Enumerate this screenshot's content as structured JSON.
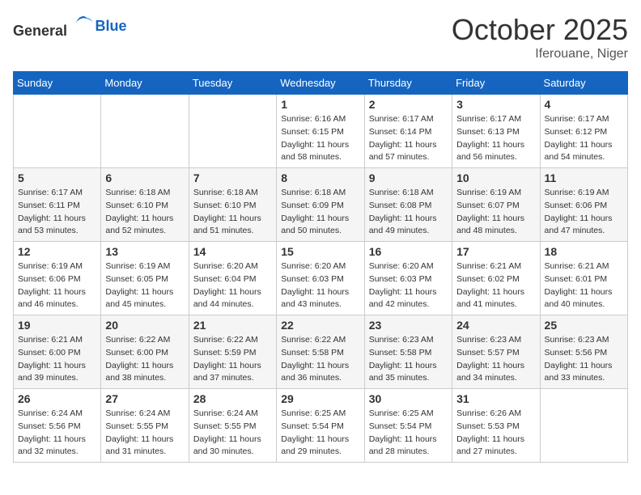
{
  "header": {
    "logo_general": "General",
    "logo_blue": "Blue",
    "month": "October 2025",
    "location": "Iferouane, Niger"
  },
  "days_of_week": [
    "Sunday",
    "Monday",
    "Tuesday",
    "Wednesday",
    "Thursday",
    "Friday",
    "Saturday"
  ],
  "weeks": [
    [
      {
        "day": "",
        "sunrise": "",
        "sunset": "",
        "daylight": ""
      },
      {
        "day": "",
        "sunrise": "",
        "sunset": "",
        "daylight": ""
      },
      {
        "day": "",
        "sunrise": "",
        "sunset": "",
        "daylight": ""
      },
      {
        "day": "1",
        "sunrise": "Sunrise: 6:16 AM",
        "sunset": "Sunset: 6:15 PM",
        "daylight": "Daylight: 11 hours and 58 minutes."
      },
      {
        "day": "2",
        "sunrise": "Sunrise: 6:17 AM",
        "sunset": "Sunset: 6:14 PM",
        "daylight": "Daylight: 11 hours and 57 minutes."
      },
      {
        "day": "3",
        "sunrise": "Sunrise: 6:17 AM",
        "sunset": "Sunset: 6:13 PM",
        "daylight": "Daylight: 11 hours and 56 minutes."
      },
      {
        "day": "4",
        "sunrise": "Sunrise: 6:17 AM",
        "sunset": "Sunset: 6:12 PM",
        "daylight": "Daylight: 11 hours and 54 minutes."
      }
    ],
    [
      {
        "day": "5",
        "sunrise": "Sunrise: 6:17 AM",
        "sunset": "Sunset: 6:11 PM",
        "daylight": "Daylight: 11 hours and 53 minutes."
      },
      {
        "day": "6",
        "sunrise": "Sunrise: 6:18 AM",
        "sunset": "Sunset: 6:10 PM",
        "daylight": "Daylight: 11 hours and 52 minutes."
      },
      {
        "day": "7",
        "sunrise": "Sunrise: 6:18 AM",
        "sunset": "Sunset: 6:10 PM",
        "daylight": "Daylight: 11 hours and 51 minutes."
      },
      {
        "day": "8",
        "sunrise": "Sunrise: 6:18 AM",
        "sunset": "Sunset: 6:09 PM",
        "daylight": "Daylight: 11 hours and 50 minutes."
      },
      {
        "day": "9",
        "sunrise": "Sunrise: 6:18 AM",
        "sunset": "Sunset: 6:08 PM",
        "daylight": "Daylight: 11 hours and 49 minutes."
      },
      {
        "day": "10",
        "sunrise": "Sunrise: 6:19 AM",
        "sunset": "Sunset: 6:07 PM",
        "daylight": "Daylight: 11 hours and 48 minutes."
      },
      {
        "day": "11",
        "sunrise": "Sunrise: 6:19 AM",
        "sunset": "Sunset: 6:06 PM",
        "daylight": "Daylight: 11 hours and 47 minutes."
      }
    ],
    [
      {
        "day": "12",
        "sunrise": "Sunrise: 6:19 AM",
        "sunset": "Sunset: 6:06 PM",
        "daylight": "Daylight: 11 hours and 46 minutes."
      },
      {
        "day": "13",
        "sunrise": "Sunrise: 6:19 AM",
        "sunset": "Sunset: 6:05 PM",
        "daylight": "Daylight: 11 hours and 45 minutes."
      },
      {
        "day": "14",
        "sunrise": "Sunrise: 6:20 AM",
        "sunset": "Sunset: 6:04 PM",
        "daylight": "Daylight: 11 hours and 44 minutes."
      },
      {
        "day": "15",
        "sunrise": "Sunrise: 6:20 AM",
        "sunset": "Sunset: 6:03 PM",
        "daylight": "Daylight: 11 hours and 43 minutes."
      },
      {
        "day": "16",
        "sunrise": "Sunrise: 6:20 AM",
        "sunset": "Sunset: 6:03 PM",
        "daylight": "Daylight: 11 hours and 42 minutes."
      },
      {
        "day": "17",
        "sunrise": "Sunrise: 6:21 AM",
        "sunset": "Sunset: 6:02 PM",
        "daylight": "Daylight: 11 hours and 41 minutes."
      },
      {
        "day": "18",
        "sunrise": "Sunrise: 6:21 AM",
        "sunset": "Sunset: 6:01 PM",
        "daylight": "Daylight: 11 hours and 40 minutes."
      }
    ],
    [
      {
        "day": "19",
        "sunrise": "Sunrise: 6:21 AM",
        "sunset": "Sunset: 6:00 PM",
        "daylight": "Daylight: 11 hours and 39 minutes."
      },
      {
        "day": "20",
        "sunrise": "Sunrise: 6:22 AM",
        "sunset": "Sunset: 6:00 PM",
        "daylight": "Daylight: 11 hours and 38 minutes."
      },
      {
        "day": "21",
        "sunrise": "Sunrise: 6:22 AM",
        "sunset": "Sunset: 5:59 PM",
        "daylight": "Daylight: 11 hours and 37 minutes."
      },
      {
        "day": "22",
        "sunrise": "Sunrise: 6:22 AM",
        "sunset": "Sunset: 5:58 PM",
        "daylight": "Daylight: 11 hours and 36 minutes."
      },
      {
        "day": "23",
        "sunrise": "Sunrise: 6:23 AM",
        "sunset": "Sunset: 5:58 PM",
        "daylight": "Daylight: 11 hours and 35 minutes."
      },
      {
        "day": "24",
        "sunrise": "Sunrise: 6:23 AM",
        "sunset": "Sunset: 5:57 PM",
        "daylight": "Daylight: 11 hours and 34 minutes."
      },
      {
        "day": "25",
        "sunrise": "Sunrise: 6:23 AM",
        "sunset": "Sunset: 5:56 PM",
        "daylight": "Daylight: 11 hours and 33 minutes."
      }
    ],
    [
      {
        "day": "26",
        "sunrise": "Sunrise: 6:24 AM",
        "sunset": "Sunset: 5:56 PM",
        "daylight": "Daylight: 11 hours and 32 minutes."
      },
      {
        "day": "27",
        "sunrise": "Sunrise: 6:24 AM",
        "sunset": "Sunset: 5:55 PM",
        "daylight": "Daylight: 11 hours and 31 minutes."
      },
      {
        "day": "28",
        "sunrise": "Sunrise: 6:24 AM",
        "sunset": "Sunset: 5:55 PM",
        "daylight": "Daylight: 11 hours and 30 minutes."
      },
      {
        "day": "29",
        "sunrise": "Sunrise: 6:25 AM",
        "sunset": "Sunset: 5:54 PM",
        "daylight": "Daylight: 11 hours and 29 minutes."
      },
      {
        "day": "30",
        "sunrise": "Sunrise: 6:25 AM",
        "sunset": "Sunset: 5:54 PM",
        "daylight": "Daylight: 11 hours and 28 minutes."
      },
      {
        "day": "31",
        "sunrise": "Sunrise: 6:26 AM",
        "sunset": "Sunset: 5:53 PM",
        "daylight": "Daylight: 11 hours and 27 minutes."
      },
      {
        "day": "",
        "sunrise": "",
        "sunset": "",
        "daylight": ""
      }
    ]
  ]
}
